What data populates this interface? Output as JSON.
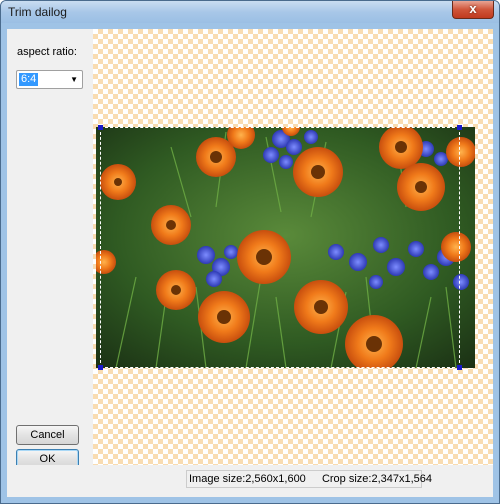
{
  "window": {
    "title": "Trim dailog",
    "close_label": "x"
  },
  "settings": {
    "aspect_label": "aspect ratio:",
    "aspect_value": "6:4"
  },
  "buttons": {
    "cancel": "Cancel",
    "ok": "OK"
  },
  "status": {
    "image_size": "Image size:2,560x1,600",
    "crop_size": "Crop size:2,347x1,564"
  },
  "colors": {
    "checker": "#f9dcb1",
    "selection_handle": "#1a1acc",
    "title_bar": "#a8c7e8"
  }
}
